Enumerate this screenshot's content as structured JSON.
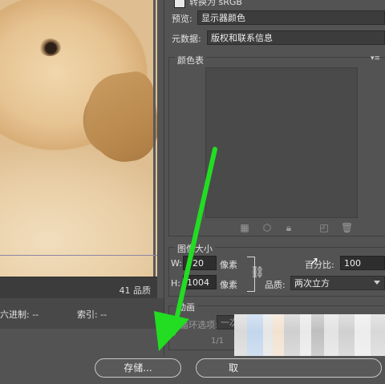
{
  "top": {
    "checkbox_label": "转换为 sRGB",
    "preview_label": "预览:",
    "preview_value": "显示器颜色",
    "metadata_label": "元数据:",
    "metadata_value": "版权和联系信息"
  },
  "color_table": {
    "title": "颜色表"
  },
  "image_size": {
    "title": "图像大小",
    "w_label": "W:",
    "w_value": "720",
    "h_label": "H:",
    "h_value": "1004",
    "unit_w": "像素",
    "unit_h": "像素",
    "percent_label": "百分比:",
    "percent_value": "100",
    "quality_label": "品质:",
    "quality_value": "两次立方"
  },
  "animation": {
    "title": "动画",
    "loop_label": "循环选项:",
    "loop_value": "一次",
    "frame_counter": "1/1"
  },
  "preview_panel": {
    "quality_text": "41 品质",
    "hex_label": "六进制: --",
    "index_label": "索引: --"
  },
  "buttons": {
    "save_label": "存储...",
    "cancel_label": "取"
  },
  "colors": {
    "arrow": "#22dd22",
    "panel_bg": "#535353"
  }
}
